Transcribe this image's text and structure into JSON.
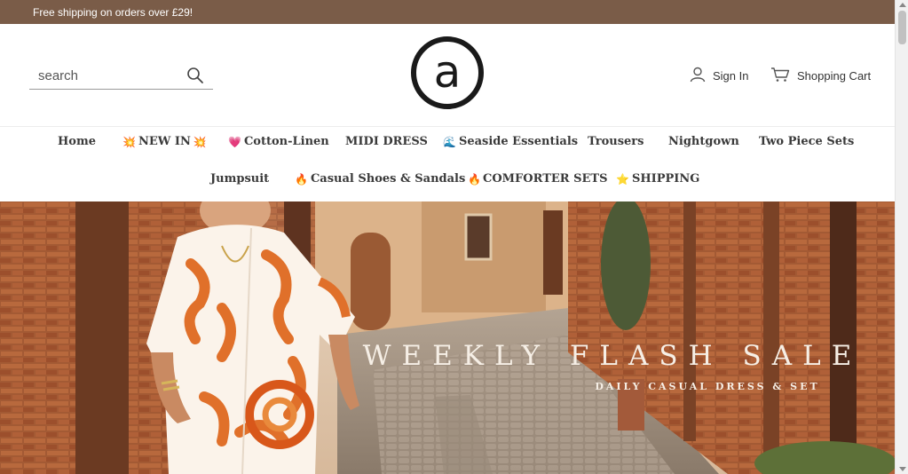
{
  "announcement": {
    "text": "Free shipping on orders over £29!"
  },
  "header": {
    "search": {
      "placeholder": "search",
      "icon": "search-icon"
    },
    "logo": {
      "icon": "at-sign-logo",
      "glyph": "a"
    },
    "account": {
      "label": "Sign In",
      "icon": "user-icon"
    },
    "cart": {
      "label": "Shopping Cart",
      "icon": "cart-icon"
    }
  },
  "nav": {
    "row1": [
      {
        "label": "Home"
      },
      {
        "label": "NEW IN",
        "emoji_left": "💥",
        "emoji_right": "💥"
      },
      {
        "label": "Cotton-Linen",
        "emoji_left": "💗"
      },
      {
        "label": "MIDI DRESS"
      },
      {
        "label": "Seaside Essentials",
        "emoji_left": "🌊"
      },
      {
        "label": "Trousers"
      },
      {
        "label": "Nightgown"
      },
      {
        "label": "Two Piece Sets"
      }
    ],
    "row2": [
      {
        "label": "Jumpsuit"
      },
      {
        "label": "Casual Shoes & Sandals",
        "emoji_left": "🔥",
        "emoji_right": "🔥"
      },
      {
        "label": "COMFORTER SETS"
      },
      {
        "label": "SHIPPING",
        "emoji_left": "⭐"
      }
    ]
  },
  "hero": {
    "title": "WEEKLY FLASH SALE",
    "subtitle": "DAILY CASUAL DRESS & SET"
  },
  "colors": {
    "announcement_bg": "#7a5c48",
    "text_dark": "#222222"
  }
}
